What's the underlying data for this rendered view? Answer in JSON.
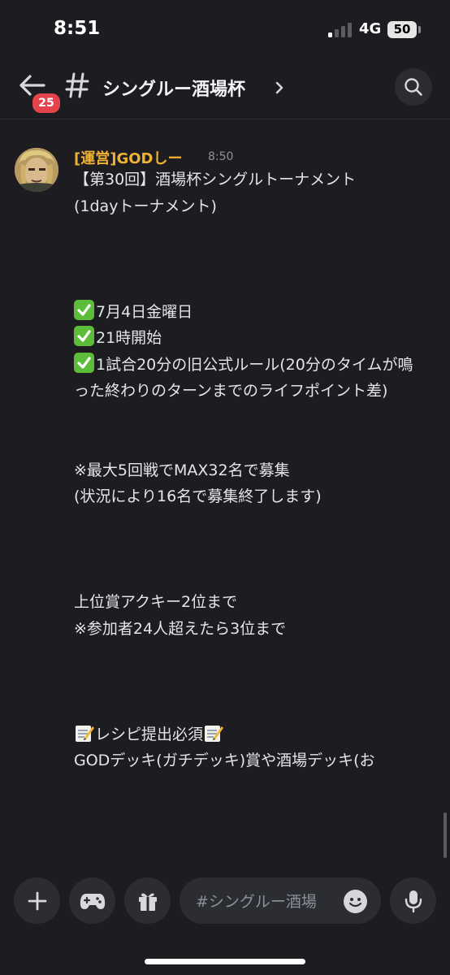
{
  "status_bar": {
    "time": "8:51",
    "network": "4G",
    "battery": "50"
  },
  "header": {
    "unread_count": "25",
    "channel_name": "シングルー酒場杯",
    "icons": [
      "back-arrow-icon",
      "hash-icon",
      "chevron-right-icon",
      "search-icon"
    ]
  },
  "message": {
    "author": "[運営]GODしー",
    "timestamp": "8:50",
    "author_color": "#f0b232",
    "lines": {
      "l1": "【第30回】酒場杯シングルトーナメント",
      "l2": "(1dayトーナメント)",
      "l3": "7月4日金曜日",
      "l4": "21時開始",
      "l5": "1試合20分の旧公式ルール(20分のタイムが鳴った終わりのターンまでのライフポイント差)",
      "l6": "※最大5回戦でMAX32名で募集",
      "l7": "(状況により16名で募集終了します)",
      "l8": "上位賞アクキー2位まで",
      "l9": "※参加者24人超えたら3位まで",
      "l10": "レシピ提出必須",
      "l11": "GODデッキ(ガチデッキ)賞や酒場デッキ(お"
    }
  },
  "composer": {
    "placeholder": "#シングルー酒場",
    "icons": [
      "plus-icon",
      "gamepad-icon",
      "gift-icon",
      "emoji-icon",
      "microphone-icon"
    ]
  }
}
